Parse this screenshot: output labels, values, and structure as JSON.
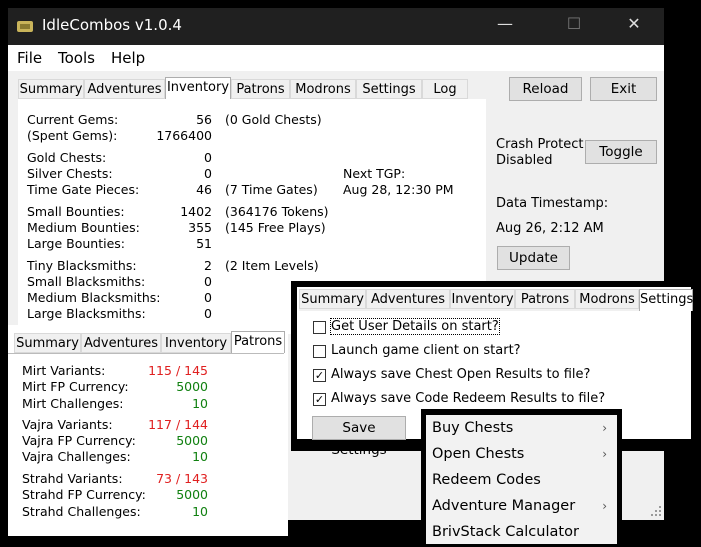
{
  "window": {
    "title": "IdleCombos v1.0.4",
    "controls": {
      "minimize": "—",
      "maximize": "☐",
      "close": "✕"
    }
  },
  "menu": [
    "File",
    "Tools",
    "Help"
  ],
  "tabs": [
    "Summary",
    "Adventures",
    "Inventory",
    "Patrons",
    "Modrons",
    "Settings",
    "Log"
  ],
  "selected_tab": "Inventory",
  "side": {
    "reload": "Reload",
    "exit": "Exit",
    "crash_protect_label": "Crash Protect",
    "crash_protect_state": "Disabled",
    "toggle": "Toggle",
    "timestamp_label": "Data Timestamp:",
    "timestamp_value": "Aug 26, 2:12 AM",
    "update": "Update"
  },
  "inventory": {
    "current_gems": {
      "label": "Current Gems:",
      "value": "56",
      "note": "(0 Gold Chests)"
    },
    "spent_gems": {
      "label": "(Spent Gems):",
      "value": "1766400"
    },
    "gold_chests": {
      "label": "Gold Chests:",
      "value": "0"
    },
    "silver_chests": {
      "label": "Silver Chests:",
      "value": "0"
    },
    "next_tgp_label": "Next TGP:",
    "time_gate_pieces": {
      "label": "Time Gate Pieces:",
      "value": "46",
      "note": "(7 Time Gates)",
      "next": "Aug 28, 12:30 PM"
    },
    "small_bounties": {
      "label": "Small Bounties:",
      "value": "1402",
      "note": "(364176 Tokens)"
    },
    "medium_bounties": {
      "label": "Medium Bounties:",
      "value": "355",
      "note": "(145 Free Plays)"
    },
    "large_bounties": {
      "label": "Large Bounties:",
      "value": "51"
    },
    "tiny_blacksmiths": {
      "label": "Tiny Blacksmiths:",
      "value": "2",
      "note": "(2 Item Levels)"
    },
    "small_blacksmiths": {
      "label": "Small Blacksmiths:",
      "value": "0"
    },
    "medium_blacksmiths": {
      "label": "Medium Blacksmiths:",
      "value": "0"
    },
    "large_blacksmiths": {
      "label": "Large Blacksmiths:",
      "value": "0"
    }
  },
  "patrons_panel": {
    "tabs": [
      "Summary",
      "Adventures",
      "Inventory",
      "Patrons"
    ],
    "selected_tab": "Patrons",
    "rows": [
      {
        "label": "Mirt Variants:",
        "value": "115 / 145",
        "color": "#e02020"
      },
      {
        "label": "Mirt FP Currency:",
        "value": "5000",
        "color": "#108010"
      },
      {
        "label": "Mirt Challenges:",
        "value": "10",
        "color": "#108010"
      },
      {
        "label": "Vajra Variants:",
        "value": "117 / 144",
        "color": "#e02020"
      },
      {
        "label": "Vajra FP Currency:",
        "value": "5000",
        "color": "#108010"
      },
      {
        "label": "Vajra Challenges:",
        "value": "10",
        "color": "#108010"
      },
      {
        "label": "Strahd Variants:",
        "value": "73 / 143",
        "color": "#e02020"
      },
      {
        "label": "Strahd FP Currency:",
        "value": "5000",
        "color": "#108010"
      },
      {
        "label": "Strahd Challenges:",
        "value": "10",
        "color": "#108010"
      }
    ]
  },
  "settings_panel": {
    "tabs": [
      "Summary",
      "Adventures",
      "Inventory",
      "Patrons",
      "Modrons",
      "Settings"
    ],
    "selected_tab": "Settings",
    "options": [
      {
        "label": "Get User Details on start?",
        "checked": false
      },
      {
        "label": "Launch game client on start?",
        "checked": false
      },
      {
        "label": "Always save Chest Open Results to file?",
        "checked": true
      },
      {
        "label": "Always save Code Redeem Results to file?",
        "checked": true
      }
    ],
    "save": "Save Settings"
  },
  "context_menu": [
    {
      "label": "Buy Chests",
      "submenu": true
    },
    {
      "label": "Open Chests",
      "submenu": true
    },
    {
      "label": "Redeem Codes",
      "submenu": false
    },
    {
      "label": "Adventure Manager",
      "submenu": true
    },
    {
      "label": "BrivStack Calculator",
      "submenu": false
    }
  ],
  "colors": {
    "accent_red": "#e02020",
    "accent_green": "#108010",
    "titlebar": "#202020"
  }
}
